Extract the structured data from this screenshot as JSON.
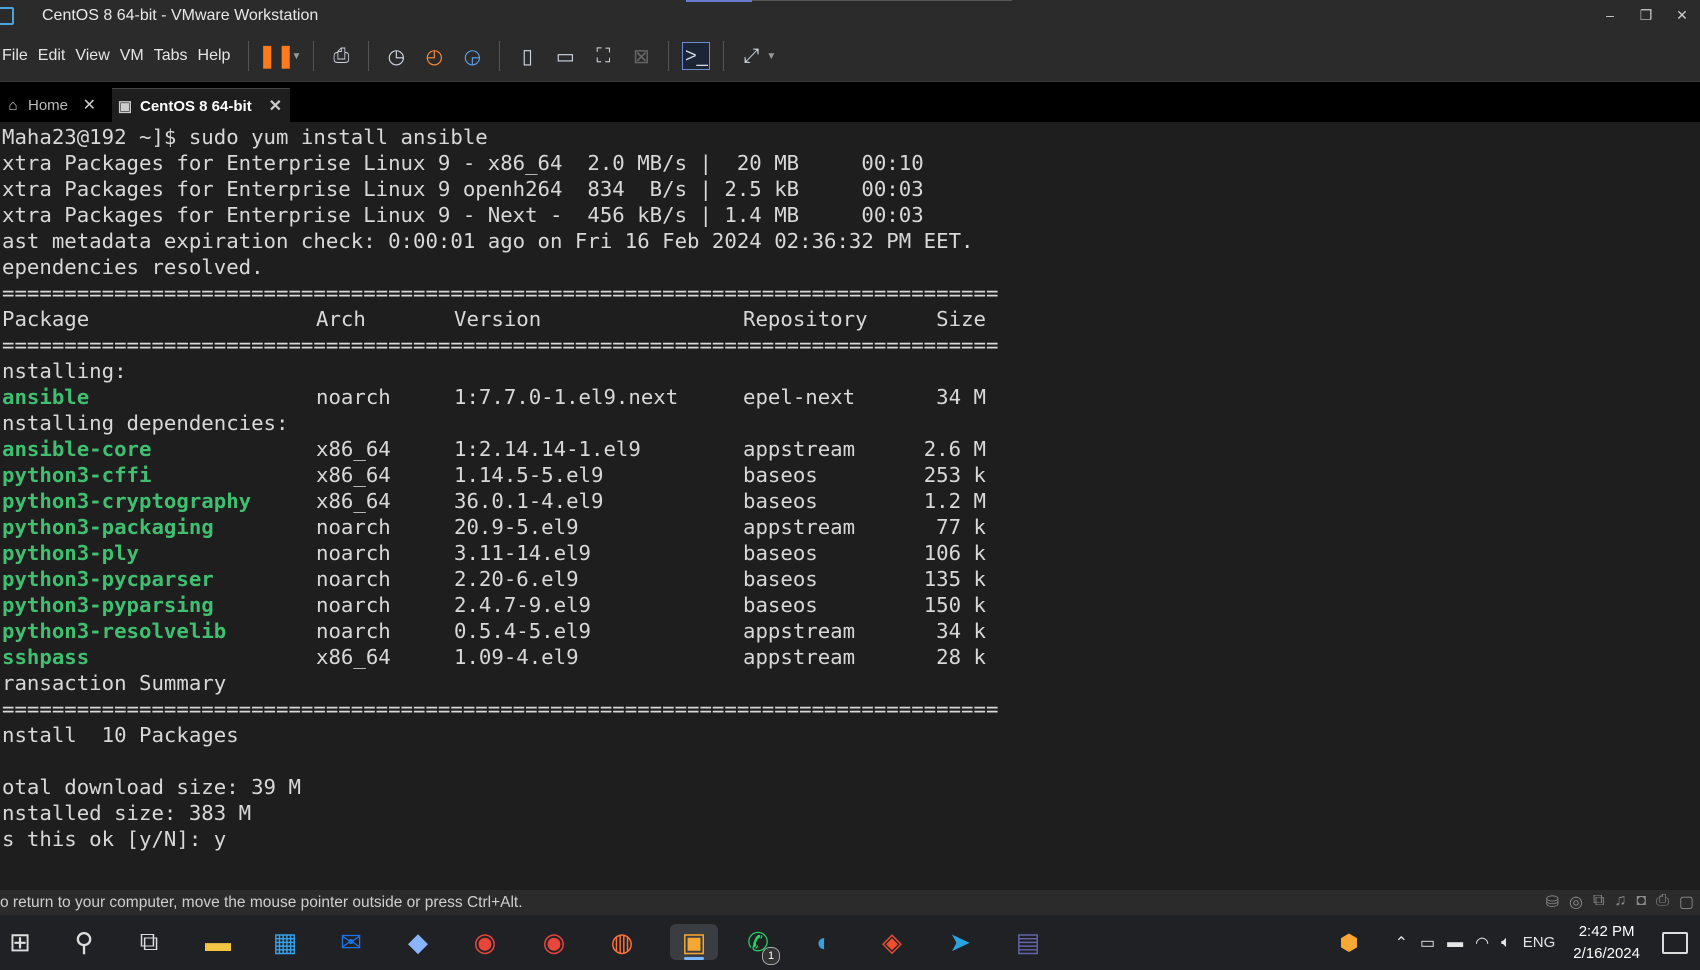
{
  "window": {
    "title": "CentOS 8 64-bit - VMware Workstation",
    "controls": [
      "–",
      "❐",
      "✕"
    ]
  },
  "menu": [
    "File",
    "Edit",
    "View",
    "VM",
    "Tabs",
    "Help"
  ],
  "tabs": [
    {
      "label": "Home",
      "active": false
    },
    {
      "label": "CentOS 8 64-bit",
      "active": true
    }
  ],
  "terminal": {
    "lines": [
      "Maha23@192 ~]$ sudo yum install ansible",
      "xtra Packages for Enterprise Linux 9 - x86_64  2.0 MB/s |  20 MB     00:10",
      "xtra Packages for Enterprise Linux 9 openh264  834  B/s | 2.5 kB     00:03",
      "xtra Packages for Enterprise Linux 9 - Next -  456 kB/s | 1.4 MB     00:03",
      "ast metadata expiration check: 0:00:01 ago on Fri 16 Feb 2024 02:36:32 PM EET.",
      "ependencies resolved.",
      "================================================================================"
    ],
    "header": {
      "package": "Package",
      "arch": "Arch",
      "version": "Version",
      "repository": "Repository",
      "size": "Size"
    },
    "separator": "================================================================================",
    "installing_label": "nstalling:",
    "main_package": {
      "name": "ansible",
      "arch": "noarch",
      "version": "1:7.7.0-1.el9.next",
      "repo": "epel-next",
      "size": "34 M"
    },
    "deps_label": "nstalling dependencies:",
    "dependencies": [
      {
        "name": "ansible-core",
        "arch": "x86_64",
        "version": "1:2.14.14-1.el9",
        "repo": "appstream",
        "size": "2.6 M"
      },
      {
        "name": "python3-cffi",
        "arch": "x86_64",
        "version": "1.14.5-5.el9",
        "repo": "baseos",
        "size": "253 k"
      },
      {
        "name": "python3-cryptography",
        "arch": "x86_64",
        "version": "36.0.1-4.el9",
        "repo": "baseos",
        "size": "1.2 M"
      },
      {
        "name": "python3-packaging",
        "arch": "noarch",
        "version": "20.9-5.el9",
        "repo": "appstream",
        "size": "77 k"
      },
      {
        "name": "python3-ply",
        "arch": "noarch",
        "version": "3.11-14.el9",
        "repo": "baseos",
        "size": "106 k"
      },
      {
        "name": "python3-pycparser",
        "arch": "noarch",
        "version": "2.20-6.el9",
        "repo": "baseos",
        "size": "135 k"
      },
      {
        "name": "python3-pyparsing",
        "arch": "noarch",
        "version": "2.4.7-9.el9",
        "repo": "baseos",
        "size": "150 k"
      },
      {
        "name": "python3-resolvelib",
        "arch": "noarch",
        "version": "0.5.4-5.el9",
        "repo": "appstream",
        "size": "34 k"
      },
      {
        "name": "sshpass",
        "arch": "x86_64",
        "version": "1.09-4.el9",
        "repo": "appstream",
        "size": "28 k"
      }
    ],
    "summary_label": "ransaction Summary",
    "install_count": "nstall  10 Packages",
    "download_size": "otal download size: 39 M",
    "installed_size": "nstalled size: 383 M",
    "prompt": "s this ok [y/N]: y"
  },
  "statusbar": {
    "message": "o return to your computer, move the mouse pointer outside or press Ctrl+Alt."
  },
  "taskbar": {
    "apps": [
      "windows-start",
      "search",
      "task-view",
      "file-explorer",
      "microsoft-store",
      "outlook-new",
      "copilot",
      "chrome",
      "chrome-profile",
      "firefox",
      "vmware-workstation",
      "whatsapp",
      "edge",
      "git",
      "telegram",
      "teams"
    ],
    "whatsapp_badge": "1",
    "language": "ENG",
    "time": "2:42 PM",
    "date": "2/16/2024"
  },
  "colors": {
    "terminal_bg": "#1e1e1e",
    "package_green": "#3fbf6f",
    "pause_orange": "#ff7a1a"
  }
}
